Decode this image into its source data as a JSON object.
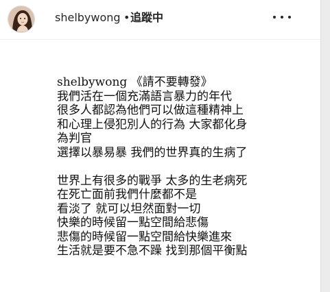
{
  "post": {
    "username": "shelbywong",
    "separator": "•",
    "follow_label": "追蹤中",
    "more_icon": "more-options-icon",
    "avatar_icon": "avatar-photo"
  },
  "caption": {
    "author": "shelbywong",
    "lines": [
      "shelbywong 《請不要轉發》",
      "我們活在一個充滿語言暴力的年代",
      "很多人都認為他們可以做這種精神上",
      "和心理上侵犯別人的行為 大家都化身",
      "為判官",
      "選擇以暴易暴 我們的世界真的生病了",
      "",
      "世界上有很多的戰爭 太多的生老病死",
      "在死亡面前我們什麼都不是",
      "看淡了 就可以坦然面對一切",
      "快樂的時候留一點空間給悲傷",
      "悲傷的時候留一點空間給快樂進來",
      "生活就是要不急不躁 找到那個平衡點"
    ]
  },
  "colors": {
    "background": "#ececec",
    "card": "#ffffff",
    "text": "#262626"
  }
}
